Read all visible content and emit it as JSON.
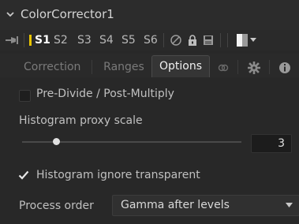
{
  "node": {
    "title": "ColorCorrector1"
  },
  "toolbar": {
    "slots": [
      "S1",
      "S2",
      "S3",
      "S4",
      "S5",
      "S6"
    ],
    "active_slot": "S1"
  },
  "tabs": [
    {
      "label": "Correction",
      "active": false
    },
    {
      "label": "Ranges",
      "active": false
    },
    {
      "label": "Options",
      "active": true
    }
  ],
  "options": {
    "premultiply_label": "Pre-Divide / Post-Multiply",
    "premultiply_checked": false,
    "histogram_proxy_label": "Histogram proxy scale",
    "histogram_proxy_value": "3",
    "ignore_transparent_label": "Histogram ignore transparent",
    "ignore_transparent_checked": true,
    "process_order_label": "Process order",
    "process_order_value": "Gamma after levels"
  },
  "colors": {
    "active_slot_marker": "#e8c400",
    "panel_bg": "#282828"
  },
  "icons": [
    "chevron-down-icon",
    "pin-icon",
    "disable-icon",
    "lock-icon",
    "save-icon",
    "color-swatch-icon",
    "link-icon",
    "gear-icon",
    "info-icon"
  ]
}
